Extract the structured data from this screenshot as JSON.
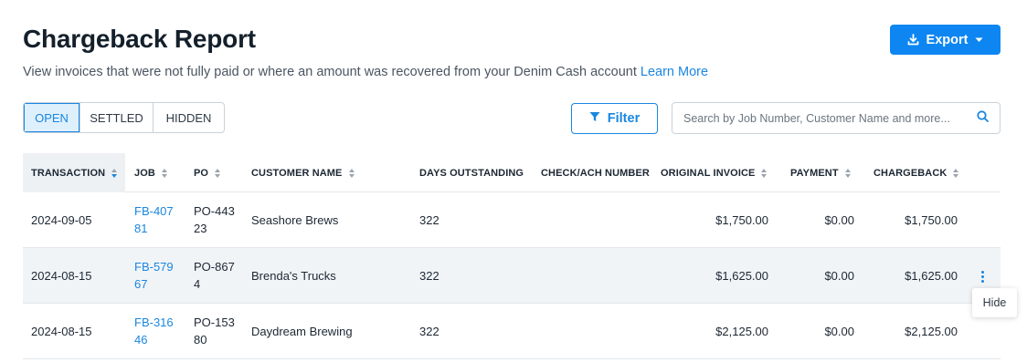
{
  "header": {
    "title": "Chargeback Report",
    "subtitle": "View invoices that were not fully paid or where an amount was recovered from your Denim Cash account",
    "learn_more": "Learn More",
    "export_label": "Export"
  },
  "tabs": [
    {
      "label": "OPEN",
      "active": true
    },
    {
      "label": "SETTLED",
      "active": false
    },
    {
      "label": "HIDDEN",
      "active": false
    }
  ],
  "filter_label": "Filter",
  "search": {
    "placeholder": "Search by Job Number, Customer Name and more...",
    "value": ""
  },
  "columns": {
    "transaction": "TRANSACTION",
    "job": "JOB",
    "po": "PO",
    "customer_name": "CUSTOMER NAME",
    "days_outstanding": "DAYS OUTSTANDING",
    "check_ach": "CHECK/ACH NUMBER",
    "original_invoice": "ORIGINAL INVOICE",
    "payment": "PAYMENT",
    "chargeback": "CHARGEBACK"
  },
  "rows": [
    {
      "transaction": "2024-09-05",
      "job": "FB-40781",
      "po": "PO-44323",
      "customer_name": "Seashore Brews",
      "days_outstanding": "322",
      "check_ach": "",
      "original_invoice": "$1,750.00",
      "payment": "$0.00",
      "chargeback": "$1,750.00"
    },
    {
      "transaction": "2024-08-15",
      "job": "FB-57967",
      "po": "PO-8674",
      "customer_name": "Brenda's Trucks",
      "days_outstanding": "322",
      "check_ach": "",
      "original_invoice": "$1,625.00",
      "payment": "$0.00",
      "chargeback": "$1,625.00"
    },
    {
      "transaction": "2024-08-15",
      "job": "FB-31646",
      "po": "PO-15380",
      "customer_name": "Daydream Brewing",
      "days_outstanding": "322",
      "check_ach": "",
      "original_invoice": "$2,125.00",
      "payment": "$0.00",
      "chargeback": "$2,125.00"
    }
  ],
  "row_menu": {
    "hide_label": "Hide"
  },
  "colors": {
    "accent": "#0d86f2",
    "link": "#1a86e0",
    "row_hover": "#f1f4f7"
  },
  "icons": {
    "export": "download-icon",
    "dropdown": "caret-down-icon",
    "filter": "funnel-icon",
    "search": "search-icon",
    "row_actions": "kebab-icon"
  }
}
